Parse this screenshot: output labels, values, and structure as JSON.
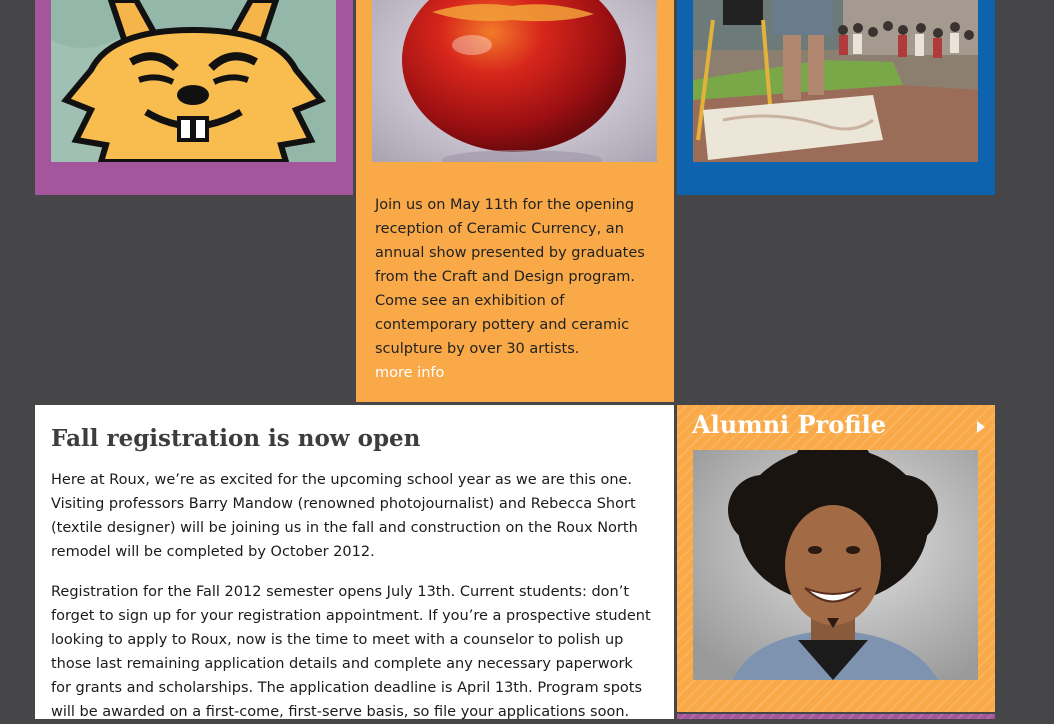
{
  "colors": {
    "background": "#464547",
    "purple": "#a3569b",
    "orange": "#f9a948",
    "blue": "#0d63ae"
  },
  "tiles": {
    "rabbit": {
      "image": "cartoon-rabbit-illustration"
    },
    "ceramic": {
      "image": "red-ceramic-vase-photo",
      "text": "Join us on May 11th for the opening reception of Ceramic Currency, an annual show presented by graduates from the Craft and Design program. Come see an exhibition of contemporary pottery and ceramic sculpture by over 30 artists.",
      "more_label": "more info"
    },
    "festival": {
      "image": "outdoor-art-festival-photo"
    }
  },
  "article": {
    "title": "Fall registration is now open",
    "p1": "Here at Roux, we’re as excited for the upcoming school year as we are this one. Visiting professors Barry Mandow (renowned photojournalist) and Rebecca Short (textile designer) will be joining us in the fall and construction on the Roux North remodel will be completed by October 2012.",
    "p2": "Registration for the Fall 2012 semester opens July 13th. Current students: don’t forget to sign up for your registration appointment. If you’re a prospective student looking to apply to Roux, now is the time to meet with a counselor to polish up those last remaining application details and complete any necessary paperwork for grants and scholarships. The application deadline is April 13th. Program spots will be awarded on a first-come, first-serve basis, so file your applications soon."
  },
  "alumni": {
    "heading": "Alumni Profile",
    "arrow_icon": "play-arrow-icon",
    "image": "smiling-alumnus-portrait"
  }
}
